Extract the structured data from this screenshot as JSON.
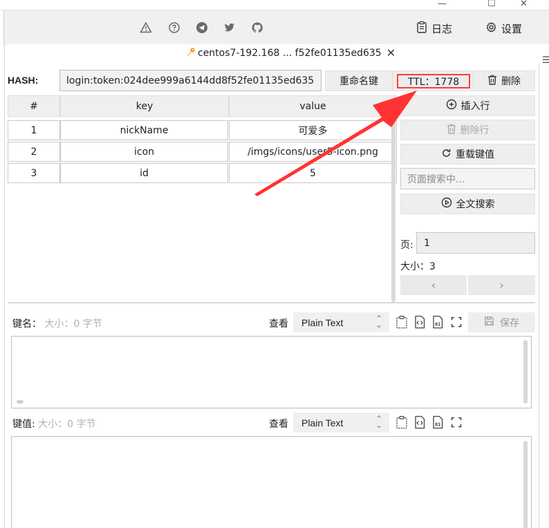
{
  "toolbar": {
    "icons": [
      "warning-icon",
      "help-icon",
      "telegram-icon",
      "twitter-icon",
      "github-icon"
    ],
    "log_label": "日志",
    "settings_label": "设置"
  },
  "tab": {
    "title": "centos7-192.168 ... f52fe01135ed635"
  },
  "key": {
    "type_label": "HASH:",
    "name": "login:token:024dee999a6144dd8f52fe01135ed635",
    "rename_label": "重命名键",
    "ttl_text": "TTL：1778",
    "delete_label": "删除"
  },
  "table": {
    "columns": [
      "#",
      "key",
      "value"
    ],
    "rows": [
      {
        "index": "1",
        "key": "nickName",
        "value": "可爱多"
      },
      {
        "index": "2",
        "key": "icon",
        "value": "/imgs/icons/user5-icon.png"
      },
      {
        "index": "3",
        "key": "id",
        "value": "5"
      }
    ]
  },
  "actions": {
    "insert_row": "插入行",
    "delete_row": "删除行",
    "reload": "重载键值",
    "search_placeholder": "页面搜索中...",
    "full_search": "全文搜索",
    "page_label": "页:",
    "page_value": "1",
    "size_label": "大小：3",
    "prev": "‹",
    "next": "›"
  },
  "editor_key": {
    "label": "键名：",
    "size": "大小：0 字节",
    "view_label": "查看",
    "format": "Plain Text",
    "save_label": "保存"
  },
  "editor_value": {
    "label": "键值:",
    "size": "大小：0 字节",
    "view_label": "查看",
    "format": "Plain Text"
  },
  "colors": {
    "annotation_red": "#ff3333",
    "panel_bg": "#eeeeee"
  }
}
